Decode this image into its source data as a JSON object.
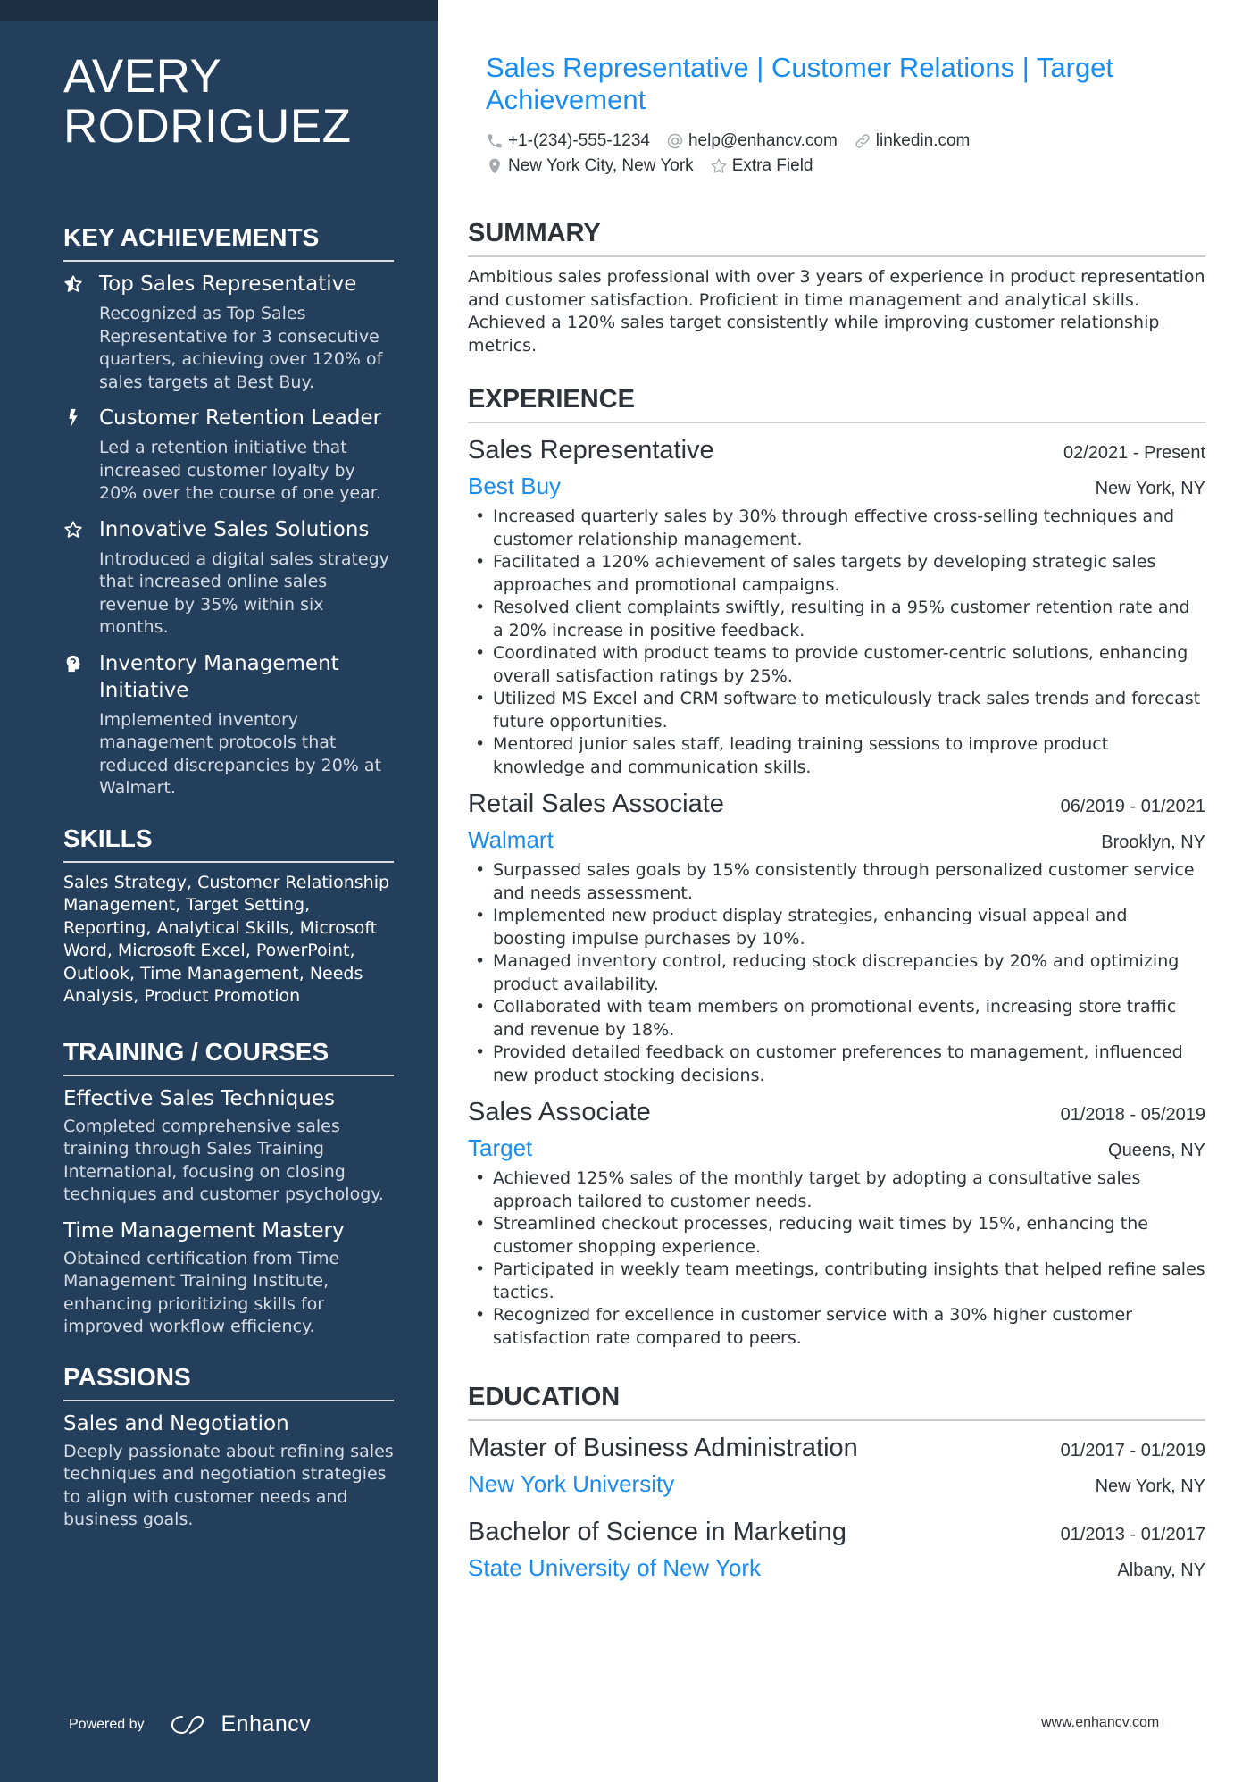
{
  "colors": {
    "sidebar_bg": "#243f5c",
    "sidebar_topband": "#1b2f45",
    "accent": "#1a8cf0",
    "text": "#2d3339"
  },
  "sidebar": {
    "name_line1": "AVERY",
    "name_line2": "RODRIGUEZ",
    "achievements": {
      "heading": "KEY ACHIEVEMENTS",
      "items": [
        {
          "icon": "star-half-icon",
          "title": "Top Sales Representative",
          "description": "Recognized as Top Sales Representative for 3 consecutive quarters, achieving over 120% of sales targets at Best Buy."
        },
        {
          "icon": "lightning-bolt-icon",
          "title": "Customer Retention Leader",
          "description": "Led a retention initiative that increased customer loyalty by 20% over the course of one year."
        },
        {
          "icon": "star-outline-icon",
          "title": "Innovative Sales Solutions",
          "description": "Introduced a digital sales strategy that increased online sales revenue by 35% within six months."
        },
        {
          "icon": "head-brain-icon",
          "title": "Inventory Management Initiative",
          "description": "Implemented inventory management protocols that reduced discrepancies by 20% at Walmart."
        }
      ]
    },
    "skills": {
      "heading": "SKILLS",
      "text": "Sales Strategy, Customer Relationship Management, Target Setting, Reporting, Analytical Skills, Microsoft Word, Microsoft Excel, PowerPoint, Outlook, Time Management, Needs Analysis, Product Promotion"
    },
    "training": {
      "heading": "TRAINING / COURSES",
      "items": [
        {
          "title": "Effective Sales Techniques",
          "description": "Completed comprehensive sales training through Sales Training International, focusing on closing techniques and customer psychology."
        },
        {
          "title": "Time Management Mastery",
          "description": "Obtained certification from Time Management Training Institute, enhancing prioritizing skills for improved workflow efficiency."
        }
      ]
    },
    "passions": {
      "heading": "PASSIONS",
      "items": [
        {
          "title": "Sales and Negotiation",
          "description": "Deeply passionate about refining sales techniques and negotiation strategies to align with customer needs and business goals."
        }
      ]
    },
    "footer": {
      "powered_by": "Powered by",
      "brand": "Enhancv"
    }
  },
  "header": {
    "headline": "Sales Representative | Customer Relations | Target Achievement",
    "contacts": {
      "phone": "+1-(234)-555-1234",
      "email": "help@enhancv.com",
      "link": "linkedin.com",
      "location": "New York City, New York",
      "extra": "Extra Field"
    }
  },
  "summary": {
    "heading": "SUMMARY",
    "text": "Ambitious sales professional with over 3 years of experience in product representation and customer satisfaction. Proficient in time management and analytical skills. Achieved a 120% sales target consistently while improving customer relationship metrics."
  },
  "experience": {
    "heading": "EXPERIENCE",
    "jobs": [
      {
        "title": "Sales Representative",
        "dates": "02/2021 - Present",
        "company": "Best Buy",
        "location": "New York, NY",
        "bullets": [
          "Increased quarterly sales by 30% through effective cross-selling techniques and customer relationship management.",
          "Facilitated a 120% achievement of sales targets by developing strategic sales approaches and promotional campaigns.",
          "Resolved client complaints swiftly, resulting in a 95% customer retention rate and a 20% increase in positive feedback.",
          "Coordinated with product teams to provide customer-centric solutions, enhancing overall satisfaction ratings by 25%.",
          "Utilized MS Excel and CRM software to meticulously track sales trends and forecast future opportunities.",
          "Mentored junior sales staff, leading training sessions to improve product knowledge and communication skills."
        ]
      },
      {
        "title": "Retail Sales Associate",
        "dates": "06/2019 - 01/2021",
        "company": "Walmart",
        "location": "Brooklyn, NY",
        "bullets": [
          "Surpassed sales goals by 15% consistently through personalized customer service and needs assessment.",
          "Implemented new product display strategies, enhancing visual appeal and boosting impulse purchases by 10%.",
          "Managed inventory control, reducing stock discrepancies by 20% and optimizing product availability.",
          "Collaborated with team members on promotional events, increasing store traffic and revenue by 18%.",
          "Provided detailed feedback on customer preferences to management, influenced new product stocking decisions."
        ]
      },
      {
        "title": "Sales Associate",
        "dates": "01/2018 - 05/2019",
        "company": "Target",
        "location": "Queens, NY",
        "bullets": [
          "Achieved 125% sales of the monthly target by adopting a consultative sales approach tailored to customer needs.",
          "Streamlined checkout processes, reducing wait times by 15%, enhancing the customer shopping experience.",
          "Participated in weekly team meetings, contributing insights that helped refine sales tactics.",
          "Recognized for excellence in customer service with a 30% higher customer satisfaction rate compared to peers."
        ]
      }
    ]
  },
  "education": {
    "heading": "EDUCATION",
    "items": [
      {
        "degree": "Master of Business Administration",
        "dates": "01/2017 - 01/2019",
        "school": "New York University",
        "location": "New York, NY"
      },
      {
        "degree": "Bachelor of Science in Marketing",
        "dates": "01/2013 - 01/2017",
        "school": "State University of New York",
        "location": "Albany, NY"
      }
    ]
  },
  "footer": {
    "site_url": "www.enhancv.com"
  }
}
